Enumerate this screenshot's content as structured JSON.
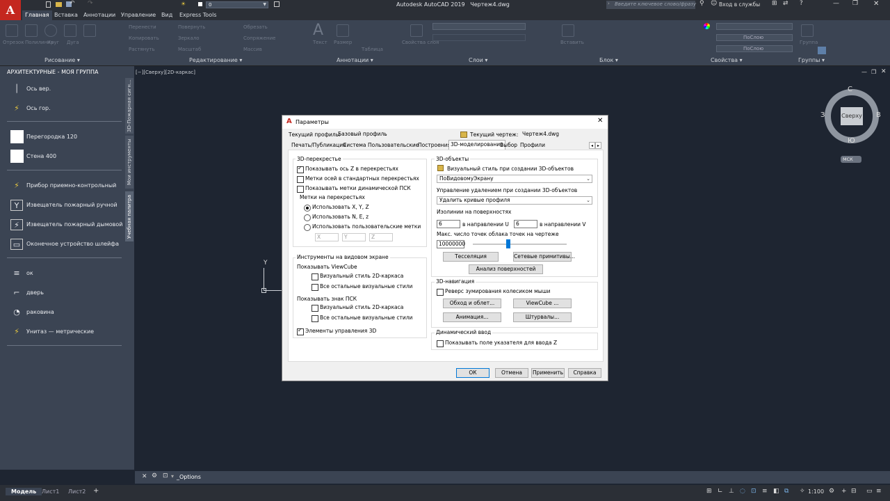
{
  "app": {
    "title": "Autodesk AutoCAD 2019",
    "document": "Чертеж4.dwg",
    "search_placeholder": "Введите ключевое слово/фразу",
    "signin": "Вход в службы",
    "layer_value": "0",
    "logo_letter": "A"
  },
  "ribbon": {
    "tabs": [
      "Главная",
      "Вставка",
      "Аннотации",
      "Управление",
      "Вид",
      "Express Tools"
    ],
    "panels": [
      "Рисование ▾",
      "Редактирование ▾",
      "Аннотации ▾",
      "Слои ▾",
      "Блок ▾",
      "Свойства ▾",
      "Группы ▾"
    ],
    "ghost_labels": [
      "Отрезок",
      "Полилиния",
      "Круг",
      "Дуга",
      "Перенести",
      "Повернуть",
      "Обрезать",
      "Копировать",
      "Зеркало",
      "Сопряжение",
      "Растянуть",
      "Масштаб",
      "Массив",
      "Текст",
      "Размер",
      "Таблица",
      "Вставить",
      "Свойства слоя",
      "Группа",
      "ПоСлою"
    ],
    "bylayer": "ПоСлою"
  },
  "palette": {
    "title": "АРХИТЕКТУРНЫЕ - МОЯ ГРУППА",
    "items": [
      {
        "label": "Ось вер.",
        "icon": "axis-vertical-icon",
        "glyph": "│"
      },
      {
        "label": "Ось гор.",
        "icon": "axis-horizontal-icon",
        "glyph": "⚡"
      },
      {
        "label": "Перегородка 120",
        "icon": "partition-icon",
        "glyph": ""
      },
      {
        "label": "Стена 400",
        "icon": "wall-icon",
        "glyph": ""
      },
      {
        "label": "Прибор приемно-контрольный",
        "icon": "control-device-icon",
        "glyph": "⚡"
      },
      {
        "label": "Извещатель пожарный ручной",
        "icon": "manual-detector-icon",
        "glyph": "Y"
      },
      {
        "label": "Извещатель пожарный дымовой",
        "icon": "smoke-detector-icon",
        "glyph": "⚡"
      },
      {
        "label": "Оконечное устройство шлейфа",
        "icon": "loop-device-icon",
        "glyph": "▭"
      },
      {
        "label": "ок",
        "icon": "window-icon",
        "glyph": "≡"
      },
      {
        "label": "дверь",
        "icon": "door-icon",
        "glyph": "⌐"
      },
      {
        "label": "раковина",
        "icon": "sink-icon",
        "glyph": "◔"
      },
      {
        "label": "Унитаз — метрические",
        "icon": "toilet-icon",
        "glyph": "⚡"
      }
    ],
    "vtabs": [
      "3D-Пожарная сигн...",
      "Мои инструменты",
      "Учебная палитра"
    ]
  },
  "viewport": {
    "label": "[−][Сверху][2D-каркас]",
    "viewcube": {
      "top": "Сверху",
      "n": "С",
      "s": "Ю",
      "w": "З",
      "e": "В",
      "ucs": "МСК"
    },
    "ucs_y": "Y"
  },
  "cmdline": {
    "text": "_Options"
  },
  "status": {
    "tabs": [
      "Модель",
      "Лист1",
      "Лист2"
    ],
    "add_tab": "+",
    "scale": "1:100"
  },
  "dialog": {
    "title": "Параметры",
    "profile_label": "Текущий профиль:",
    "profile_value": "Базовый профиль",
    "drawing_label": "Текущий чертеж:",
    "drawing_value": "Чертеж4.dwg",
    "tabs": [
      "Печать/Публикация",
      "Система",
      "Пользовательские",
      "Построения",
      "3D-моделирование",
      "Выбор",
      "Профили"
    ],
    "active_tab": 4,
    "left": {
      "crosshair_group": "3D-перекрестье",
      "show_z": "Показывать ось Z в перекрестьях",
      "axis_labels_std": "Метки осей в стандартных перекрестьях",
      "dyn_ucs_labels": "Показывать метки динамической ПСК",
      "crosshair_labels": "Метки на перекрестьях",
      "radio_xyz": "Использовать X, Y, Z",
      "radio_nez": "Использовать N, E, z",
      "radio_custom": "Использовать пользовательские метки",
      "custom_x": "X",
      "custom_y": "Y",
      "custom_z": "Z",
      "viewport_tools_group": "Инструменты на видовом экране",
      "show_viewcube": "Показывать ViewCube",
      "vc_2d": "Визуальный стиль 2D-каркаса",
      "vc_other": "Все остальные визуальные стили",
      "show_ucs": "Показывать знак ПСК",
      "ucs_2d": "Визуальный стиль 2D-каркаса",
      "ucs_other": "Все остальные визуальные стили",
      "ctrl_3d": "Элементы управления 3D"
    },
    "right": {
      "objects_group": "3D-объекты",
      "vis_style_label": "Визуальный стиль при создании 3D-объектов",
      "vis_style_value": "ПоВидовомуЭкрану",
      "deletion_label": "Управление удалением при создании 3D-объектов",
      "deletion_value": "Удалить кривые профиля",
      "isolines_label": "Изолинии на поверхностях",
      "u_value": "6",
      "u_label": "в направлении U",
      "v_value": "6",
      "v_label": "в направлении V",
      "maxpoints_label": "Макс. число точек облака точек на чертеже",
      "maxpoints_value": "10000000",
      "tessellation_btn": "Тесселяция",
      "mesh_btn": "Сетевые примитивы...",
      "analysis_btn": "Анализ поверхностей",
      "nav_group": "3D-навигация",
      "reverse_zoom": "Реверс зумирования колесиком мыши",
      "walkfly_btn": "Обход и облет...",
      "viewcube_btn": "ViewCube ...",
      "animation_btn": "Анимация...",
      "steering_btn": "Штурвалы...",
      "dynamic_group": "Динамический ввод",
      "show_z_field": "Показывать поле указателя для ввода Z"
    },
    "buttons": {
      "ok": "ОК",
      "cancel": "Отмена",
      "apply": "Применить",
      "help": "Справка"
    }
  },
  "colors": {
    "accent": "#0078d7",
    "ribbon_bg": "#3b4453",
    "model_bg": "#1e2531",
    "logo_red": "#c4271f"
  }
}
